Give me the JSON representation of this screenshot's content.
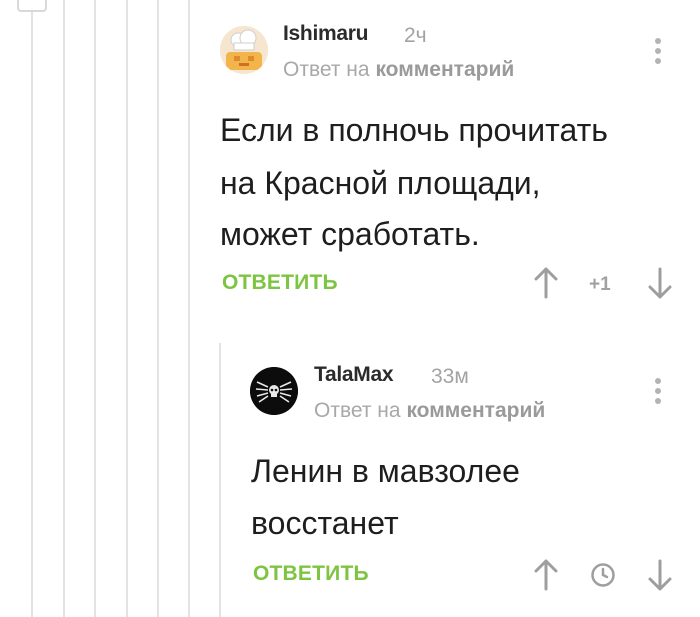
{
  "comments": [
    {
      "author": "Ishimaru",
      "time": "2ч",
      "reply_prefix": "Ответ на",
      "reply_link": "комментарий",
      "text_lines": [
        "Если в полночь прочитать",
        "на Красной площади,",
        "может сработать."
      ],
      "reply_label": "ОТВЕТИТЬ",
      "score": "+1",
      "avatar_icon": "chef-hat-avatar"
    },
    {
      "author": "TalaMax",
      "time": "33м",
      "reply_prefix": "Ответ на",
      "reply_link": "комментарий",
      "text_lines": [
        "Ленин в мавзолее",
        "восстанет"
      ],
      "reply_label": "ОТВЕТИТЬ",
      "score_icon": "clock-icon",
      "avatar_icon": "skull-wings-avatar"
    }
  ],
  "colors": {
    "accent_green": "#7dc440",
    "muted": "#a3a3a3",
    "thread_line": "#e3e3e3"
  }
}
